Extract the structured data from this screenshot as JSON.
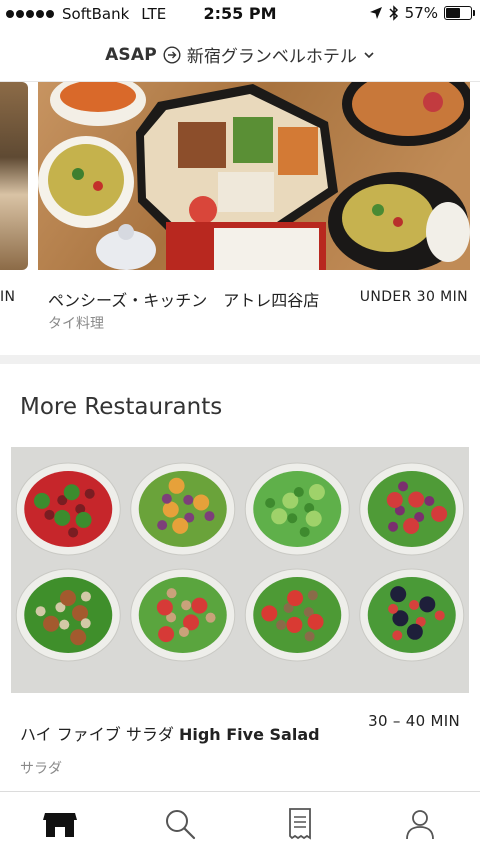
{
  "status_bar": {
    "carrier": "SoftBank",
    "network": "LTE",
    "time": "2:55 PM",
    "battery_text": "57%",
    "battery_level": 0.57
  },
  "header": {
    "asap": "ASAP",
    "location": "新宿グランベルホテル"
  },
  "featured": {
    "left_fragment": "IN",
    "name": "ペンシーズ・キッチン　アトレ四谷店",
    "time": "UNDER 30 MIN",
    "cuisine": "タイ料理"
  },
  "section": {
    "title": "More Restaurants"
  },
  "restaurant": {
    "name_ja": "ハイ ファイブ サラダ",
    "name_en": "High Five Salad",
    "time": "30 – 40 MIN",
    "cuisine": "サラダ"
  },
  "tabs": [
    {
      "icon": "store-icon",
      "active": true
    },
    {
      "icon": "search-icon",
      "active": false
    },
    {
      "icon": "receipt-icon",
      "active": false
    },
    {
      "icon": "profile-icon",
      "active": false
    }
  ]
}
